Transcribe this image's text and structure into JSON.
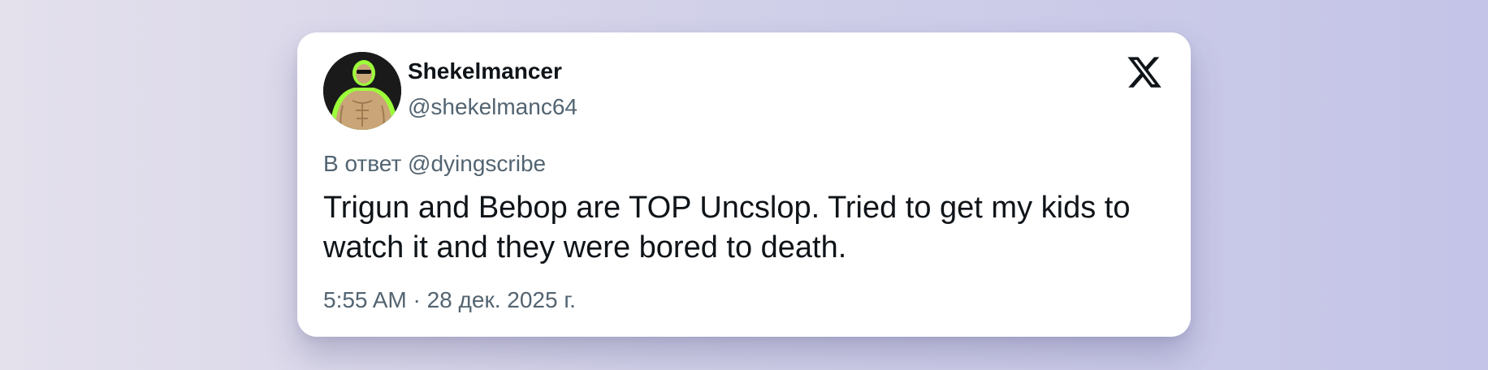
{
  "tweet": {
    "author": {
      "display_name": "Shekelmancer",
      "handle": "@shekelmanc64",
      "avatar_icon": "muscular-green-outlined-figure-avatar"
    },
    "reply_to": "В ответ @dyingscribe",
    "text": "Trigun and Bebop are TOP Uncslop. Tried to get my kids to watch it and they were bored to death.",
    "timestamp": "5:55 AM · 28 дек. 2025 г.",
    "platform_icon": "x-logo-icon"
  },
  "colors": {
    "text_primary": "#0f1419",
    "text_secondary": "#536471",
    "card_background": "#ffffff",
    "avatar_glow": "#9cff3a"
  }
}
